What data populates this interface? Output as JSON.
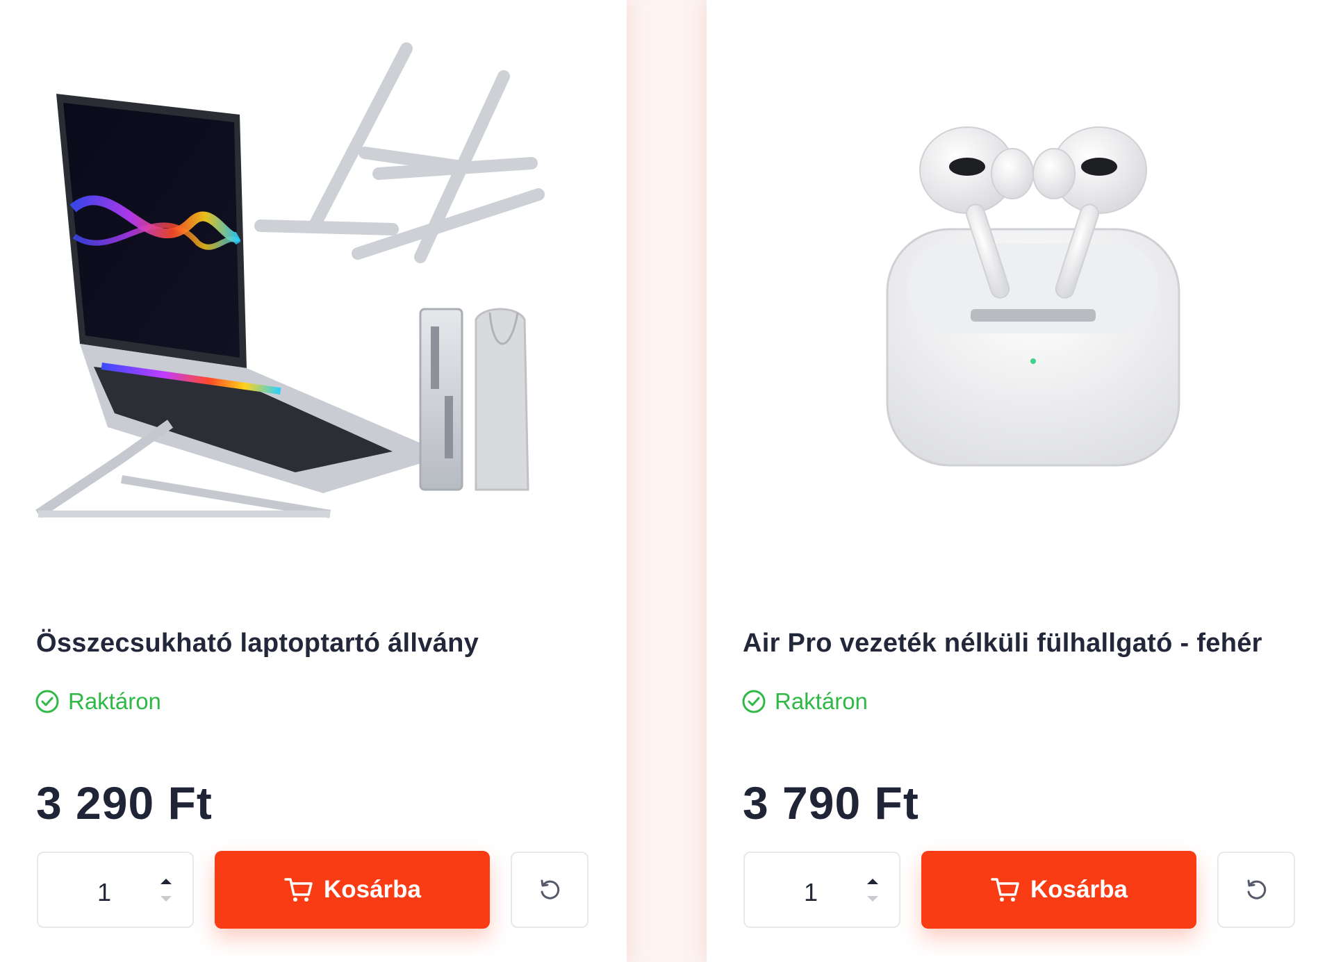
{
  "products": [
    {
      "title": "Összecsukható laptoptartó állvány",
      "stock_label": "Raktáron",
      "price": "3 290 Ft",
      "quantity": "1",
      "add_to_cart_label": "Kosárba",
      "image_icon": "laptop-stand-image"
    },
    {
      "title": "Air Pro vezeték nélküli fülhallgató - fehér",
      "stock_label": "Raktáron",
      "price": "3 790 Ft",
      "quantity": "1",
      "add_to_cart_label": "Kosárba",
      "image_icon": "earbuds-image"
    }
  ],
  "colors": {
    "accent": "#fa3c15",
    "in_stock": "#2fb845",
    "text": "#22273a"
  }
}
